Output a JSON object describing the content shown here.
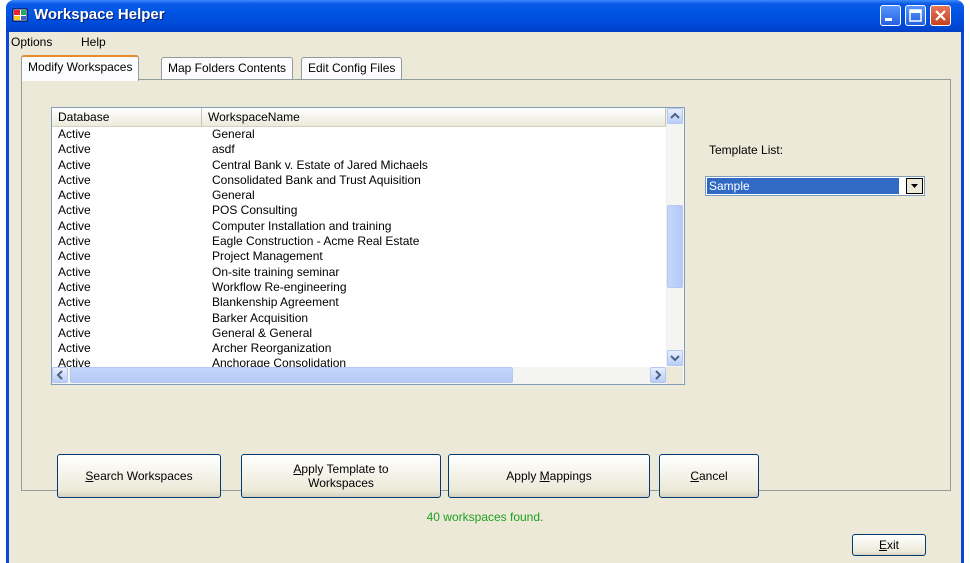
{
  "window": {
    "title": "Workspace Helper"
  },
  "menu": {
    "items": [
      "Options",
      "Help"
    ]
  },
  "tabs": [
    {
      "label": "Modify Workspaces",
      "active": true
    },
    {
      "label": "Map Folders Contents",
      "active": false
    },
    {
      "label": "Edit Config Files",
      "active": false
    }
  ],
  "list": {
    "columns": [
      "Database",
      "WorkspaceName"
    ],
    "rows": [
      [
        "Active",
        "General"
      ],
      [
        "Active",
        "asdf"
      ],
      [
        "Active",
        "Central Bank v. Estate of Jared Michaels"
      ],
      [
        "Active",
        "Consolidated Bank and Trust Aquisition"
      ],
      [
        "Active",
        "General"
      ],
      [
        "Active",
        "POS Consulting"
      ],
      [
        "Active",
        "Computer Installation and training"
      ],
      [
        "Active",
        "Eagle Construction - Acme Real Estate"
      ],
      [
        "Active",
        "Project Management"
      ],
      [
        "Active",
        "On-site training seminar"
      ],
      [
        "Active",
        "Workflow Re-engineering"
      ],
      [
        "Active",
        "Blankenship Agreement"
      ],
      [
        "Active",
        "Barker Acquisition"
      ],
      [
        "Active",
        "General & General"
      ],
      [
        "Active",
        "Archer Reorganization"
      ],
      [
        "Active",
        "Anchorage Consolidation"
      ]
    ]
  },
  "template": {
    "label": "Template List:",
    "selected": "Sample"
  },
  "buttons": {
    "search": {
      "mnemonic": "S",
      "rest": "earch Workspaces"
    },
    "apply_template": {
      "mnemonic": "A",
      "rest": "pply Template to",
      "line2": "Workspaces"
    },
    "apply_mappings": {
      "before": "Apply ",
      "mnemonic": "M",
      "rest": "appings"
    },
    "cancel": {
      "mnemonic": "C",
      "rest": "ancel"
    },
    "exit": {
      "mnemonic": "E",
      "rest": "xit"
    }
  },
  "status": {
    "text": "40 workspaces found."
  },
  "colors": {
    "title_bar": "#0054e3",
    "status": "#1ea01e",
    "selection": "#316ac5",
    "face": "#ece9d8"
  },
  "icons": [
    "app-icon",
    "minimize-icon",
    "maximize-icon",
    "close-icon",
    "scroll-up-icon",
    "scroll-down-icon",
    "scroll-left-icon",
    "scroll-right-icon",
    "dropdown-arrow-icon"
  ]
}
